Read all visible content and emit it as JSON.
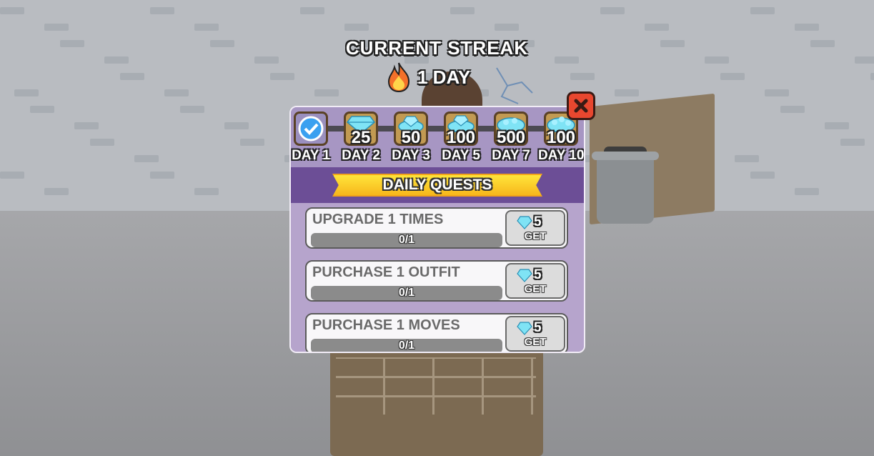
{
  "colors": {
    "panel": "#b6a4cc",
    "quests_header": "#6c4e96",
    "banner": "#f7b71c",
    "close": "#e8472f",
    "gem": "#7fe3f5"
  },
  "streak": {
    "title": "CURRENT STREAK",
    "value": "1 DAY",
    "icon": "flame-icon"
  },
  "rewards": [
    {
      "day": "DAY 1",
      "amount": "",
      "icon": "checkmark-icon",
      "claimed": true
    },
    {
      "day": "DAY 2",
      "amount": "25",
      "icon": "gem-icon",
      "claimed": false
    },
    {
      "day": "DAY 3",
      "amount": "50",
      "icon": "gem-pile-icon",
      "claimed": false
    },
    {
      "day": "DAY 5",
      "amount": "100",
      "icon": "gem-pile-icon",
      "claimed": false
    },
    {
      "day": "DAY 7",
      "amount": "500",
      "icon": "gem-pile-icon",
      "claimed": false
    },
    {
      "day": "DAY 10",
      "amount": "100",
      "icon": "gem-pile-icon",
      "claimed": false
    }
  ],
  "daily_quests": {
    "title": "DAILY QUESTS",
    "items": [
      {
        "title": "UPGRADE 1 TIMES",
        "progress_text": "0/1",
        "progress": 0,
        "reward": "5",
        "button_label": "GET"
      },
      {
        "title": "PURCHASE 1 OUTFIT",
        "progress_text": "0/1",
        "progress": 0,
        "reward": "5",
        "button_label": "GET"
      },
      {
        "title": "PURCHASE 1 MOVES",
        "progress_text": "0/1",
        "progress": 0,
        "reward": "5",
        "button_label": "GET"
      }
    ]
  },
  "close": {
    "icon": "close-icon"
  }
}
